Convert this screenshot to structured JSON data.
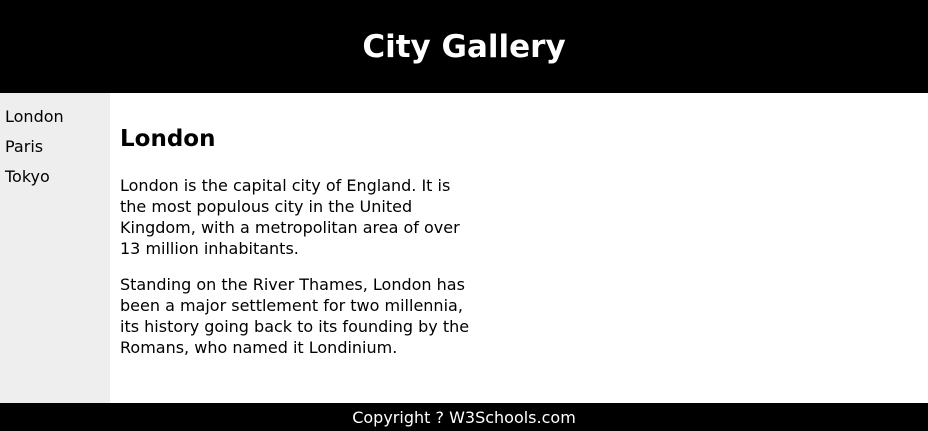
{
  "header": {
    "title": "City Gallery"
  },
  "nav": {
    "items": [
      {
        "label": "London"
      },
      {
        "label": "Paris"
      },
      {
        "label": "Tokyo"
      }
    ]
  },
  "main": {
    "heading": "London",
    "paragraphs": [
      "London is the capital city of England. It is the most populous city in the United Kingdom, with a metropolitan area of over 13 million inhabitants.",
      "Standing on the River Thames, London has been a major settlement for two millennia, its history going back to its founding by the Romans, who named it Londinium."
    ]
  },
  "footer": {
    "text": "Copyright ? W3Schools.com"
  },
  "colors": {
    "header_bg": "#000000",
    "nav_bg": "#eeeeee",
    "footer_bg": "#000000"
  }
}
